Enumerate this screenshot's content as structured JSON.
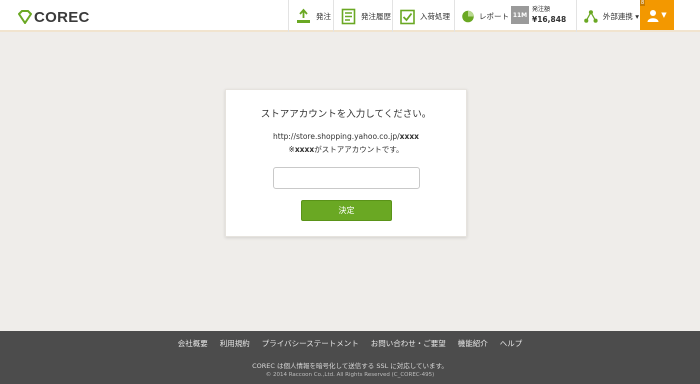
{
  "header": {
    "logo_text": "COREC",
    "nav": [
      {
        "label": "発注",
        "icon": "order-icon"
      },
      {
        "label": "発注履歴",
        "icon": "order-history-icon"
      },
      {
        "label": "入荷処理",
        "icon": "receiving-icon"
      },
      {
        "label": "レポート",
        "icon": "report-icon"
      }
    ],
    "badge": "11M",
    "order_amount_label": "発注額",
    "order_amount_value": "¥16,848",
    "external": {
      "label": "外部連携 ▾",
      "icon": "external-link-icon"
    },
    "user": {
      "count": "8",
      "icon": "user-icon"
    },
    "colors": {
      "accent": "#6aa823",
      "user": "#f39800"
    }
  },
  "modal": {
    "title": "ストアアカウントを入力してください。",
    "url_prefix": "http://store.shopping.yahoo.co.jp/",
    "url_highlight": "xxxx",
    "note_prefix": "※",
    "note_highlight": "xxxx",
    "note_suffix": "がストアアカウントです。",
    "input_value": "",
    "input_placeholder": "",
    "submit_label": "決定"
  },
  "footer": {
    "links": [
      "会社概要",
      "利用規約",
      "プライバシーステートメント",
      "お問い合わせ・ご要望",
      "機能紹介",
      "ヘルプ"
    ],
    "ssl_note": "COREC は個人情報を暗号化して送信する SSL に対応しています。",
    "copyright": "© 2014 Raccoon Co.,Ltd. All Rights Reserved (C_COREC-495)"
  }
}
